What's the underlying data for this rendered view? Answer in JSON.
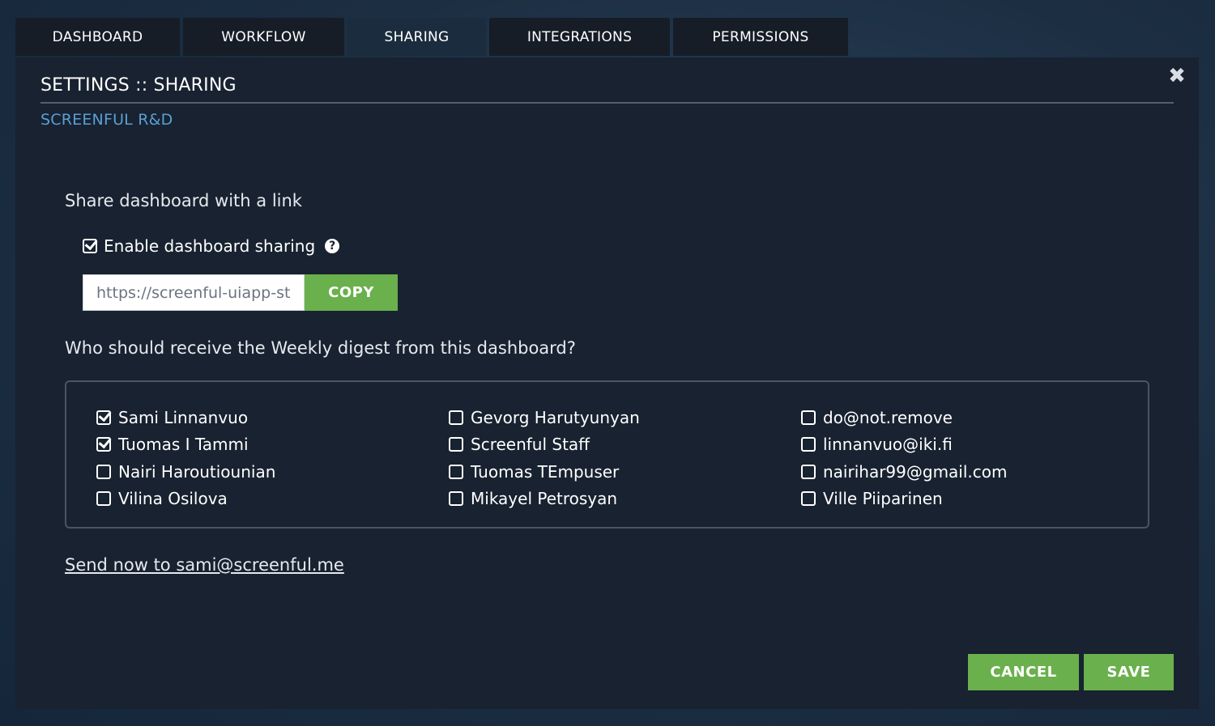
{
  "tabs": [
    {
      "label": "DASHBOARD"
    },
    {
      "label": "WORKFLOW"
    },
    {
      "label": "SHARING"
    },
    {
      "label": "INTEGRATIONS"
    },
    {
      "label": "PERMISSIONS"
    }
  ],
  "modal": {
    "title": "SETTINGS :: SHARING",
    "subtitle": "SCREENFUL R&D",
    "close_icon": "✖"
  },
  "sharing": {
    "heading": "Share dashboard with a link",
    "enable_label": "Enable dashboard sharing",
    "enable_checked": true,
    "help_icon": "?",
    "link_value": "https://screenful-uiapp-sta",
    "copy_label": "COPY"
  },
  "digest": {
    "heading": "Who should receive the Weekly digest from this dashboard?",
    "columns": [
      [
        {
          "name": "Sami Linnanvuo",
          "checked": true
        },
        {
          "name": "Tuomas I Tammi",
          "checked": true
        },
        {
          "name": "Nairi Haroutiounian",
          "checked": false
        },
        {
          "name": "Vilina Osilova",
          "checked": false
        }
      ],
      [
        {
          "name": "Gevorg Harutyunyan",
          "checked": false
        },
        {
          "name": "Screenful Staff",
          "checked": false
        },
        {
          "name": "Tuomas TEmpuser",
          "checked": false
        },
        {
          "name": "Mikayel Petrosyan",
          "checked": false
        }
      ],
      [
        {
          "name": "do@not.remove",
          "checked": false
        },
        {
          "name": "linnanvuo@iki.fi",
          "checked": false
        },
        {
          "name": "nairihar99@gmail.com",
          "checked": false
        },
        {
          "name": "Ville Piiparinen",
          "checked": false
        }
      ]
    ],
    "send_now": "Send now to sami@screenful.me"
  },
  "footer": {
    "cancel_label": "CANCEL",
    "save_label": "SAVE"
  },
  "colors": {
    "accent_green": "#6ab04c",
    "link_blue": "#5a9fd4",
    "modal_bg": "#182230"
  }
}
